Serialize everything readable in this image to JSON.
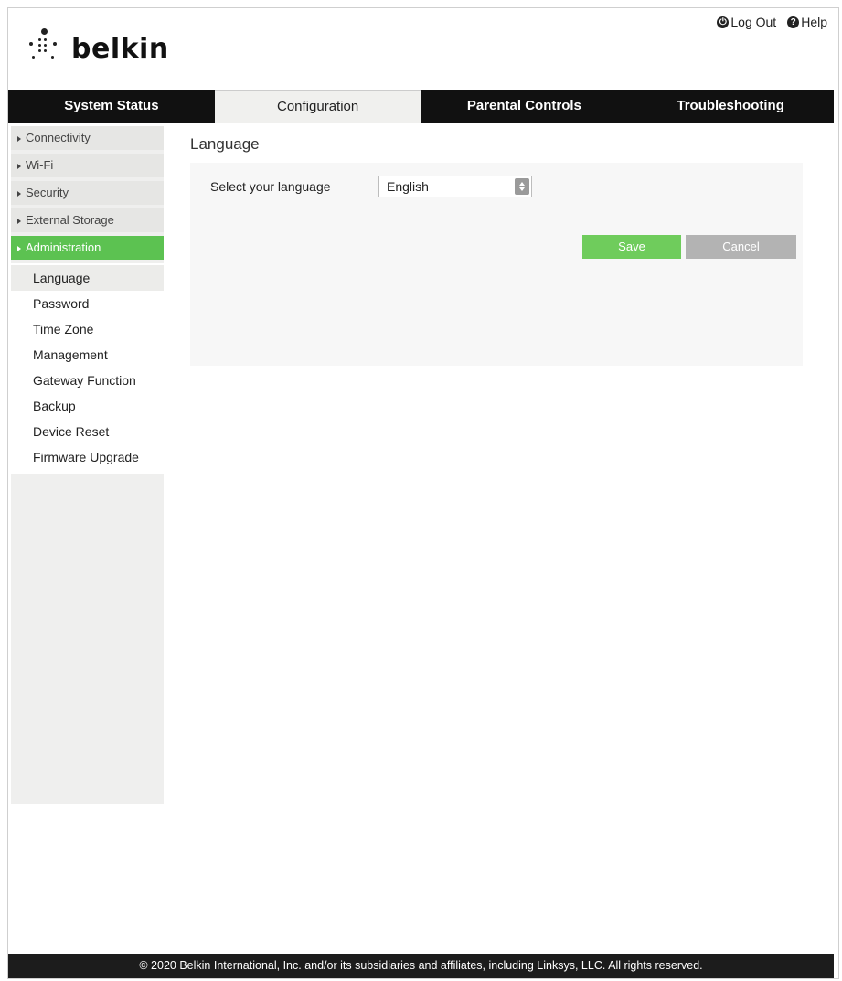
{
  "brand": {
    "name": "belkin"
  },
  "top_links": {
    "logout": "Log Out",
    "help": "Help"
  },
  "nav": {
    "tabs": [
      {
        "label": "System Status",
        "active": false
      },
      {
        "label": "Configuration",
        "active": true
      },
      {
        "label": "Parental Controls",
        "active": false
      },
      {
        "label": "Troubleshooting",
        "active": false
      }
    ]
  },
  "sidebar": {
    "items": [
      {
        "label": "Connectivity"
      },
      {
        "label": "Wi-Fi"
      },
      {
        "label": "Security"
      },
      {
        "label": "External Storage"
      },
      {
        "label": "Administration",
        "active": true
      }
    ],
    "subitems": [
      {
        "label": "Language",
        "active": true
      },
      {
        "label": "Password"
      },
      {
        "label": "Time Zone"
      },
      {
        "label": "Management"
      },
      {
        "label": "Gateway Function"
      },
      {
        "label": "Backup"
      },
      {
        "label": "Device Reset"
      },
      {
        "label": "Firmware Upgrade"
      }
    ]
  },
  "content": {
    "title": "Language",
    "language_label": "Select your language",
    "language_value": "English",
    "save": "Save",
    "cancel": "Cancel"
  },
  "footer": {
    "text": "© 2020 Belkin International, Inc. and/or its subsidiaries and affiliates, including Linksys, LLC. All rights reserved."
  },
  "colors": {
    "accent_green": "#5cc251",
    "nav_bg": "#111111",
    "footer_bg": "#1c1c1c"
  }
}
